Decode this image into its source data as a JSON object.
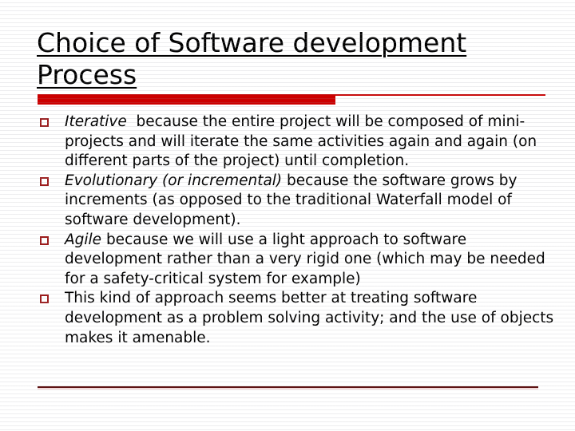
{
  "slide": {
    "title": {
      "line1": "Choice of Software development",
      "line2": "Process"
    },
    "accent_color": "#cc0000",
    "bullet_color": "#9c1c1c",
    "rule_color": "#5e1414",
    "text_color": "#000000",
    "background_color": "#ffffff",
    "bullets": [
      {
        "marker": "hollow-square-bullet",
        "emphasis": "Iterative",
        "emphasis_style": "italic",
        "rest": "  because the entire project will be composed of mini-projects and will iterate the same activities again and again (on different parts of the project) until completion.",
        "full_text": "Iterative  because the entire project will be composed of mini-projects and will iterate the same activities again and again (on different parts of the project) until completion."
      },
      {
        "marker": "hollow-square-bullet",
        "emphasis": "Evolutionary (or incremental)",
        "emphasis_style": "italic",
        "rest": " because the software grows by increments (as opposed to the traditional Waterfall model of software development).",
        "full_text": "Evolutionary (or incremental) because the software grows by increments (as opposed to the traditional Waterfall model of software development)."
      },
      {
        "marker": "hollow-square-bullet",
        "emphasis": "Agile",
        "emphasis_style": "italic",
        "rest": " because we will use a light approach to software development rather than a very rigid one (which may be needed for a safety-critical system for example)",
        "full_text": "Agile because we will use a light approach to software development rather than a very rigid one (which may be needed for a safety-critical system for example)"
      },
      {
        "marker": "hollow-square-bullet",
        "emphasis": "",
        "emphasis_style": "normal",
        "rest": "This kind of approach seems better at treating software development as a problem solving activity; and the use of objects makes it amenable.",
        "full_text": "This kind of approach seems better at treating software development as a problem solving activity; and the use of objects makes it amenable."
      }
    ]
  }
}
